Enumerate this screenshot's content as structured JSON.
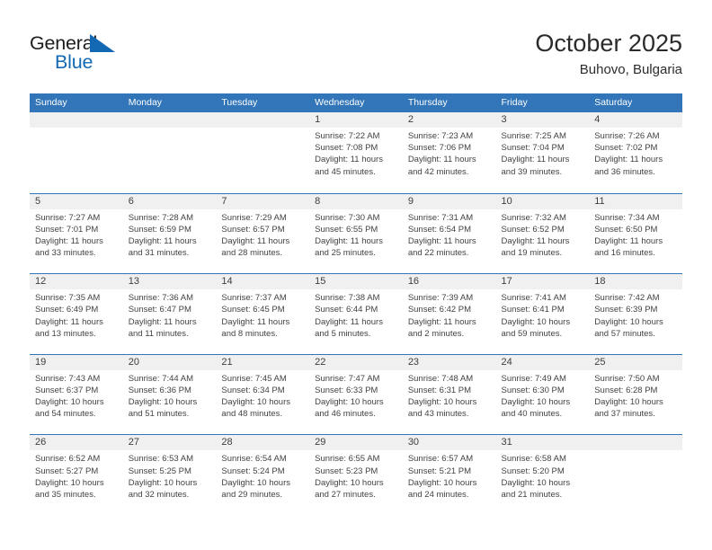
{
  "brand": {
    "name_top": "General",
    "name_bottom": "Blue",
    "triangle_color": "#1268b3"
  },
  "header": {
    "title": "October 2025",
    "location": "Buhovo, Bulgaria"
  },
  "theme": {
    "header_blue": "#3275b8",
    "band_gray": "#f0f0f0",
    "text_dark": "#434343",
    "brand_blue": "#1268b3"
  },
  "weekdays": [
    {
      "label": "Sunday"
    },
    {
      "label": "Monday"
    },
    {
      "label": "Tuesday"
    },
    {
      "label": "Wednesday"
    },
    {
      "label": "Thursday"
    },
    {
      "label": "Friday"
    },
    {
      "label": "Saturday"
    }
  ],
  "weeks": [
    {
      "days": [
        {
          "num": "",
          "l1": "",
          "l2": "",
          "l3": "",
          "l4": "",
          "empty": true
        },
        {
          "num": "",
          "l1": "",
          "l2": "",
          "l3": "",
          "l4": "",
          "empty": true
        },
        {
          "num": "",
          "l1": "",
          "l2": "",
          "l3": "",
          "l4": "",
          "empty": true
        },
        {
          "num": "1",
          "l1": "Sunrise: 7:22 AM",
          "l2": "Sunset: 7:08 PM",
          "l3": "Daylight: 11 hours",
          "l4": "and 45 minutes."
        },
        {
          "num": "2",
          "l1": "Sunrise: 7:23 AM",
          "l2": "Sunset: 7:06 PM",
          "l3": "Daylight: 11 hours",
          "l4": "and 42 minutes."
        },
        {
          "num": "3",
          "l1": "Sunrise: 7:25 AM",
          "l2": "Sunset: 7:04 PM",
          "l3": "Daylight: 11 hours",
          "l4": "and 39 minutes."
        },
        {
          "num": "4",
          "l1": "Sunrise: 7:26 AM",
          "l2": "Sunset: 7:02 PM",
          "l3": "Daylight: 11 hours",
          "l4": "and 36 minutes."
        }
      ]
    },
    {
      "days": [
        {
          "num": "5",
          "l1": "Sunrise: 7:27 AM",
          "l2": "Sunset: 7:01 PM",
          "l3": "Daylight: 11 hours",
          "l4": "and 33 minutes."
        },
        {
          "num": "6",
          "l1": "Sunrise: 7:28 AM",
          "l2": "Sunset: 6:59 PM",
          "l3": "Daylight: 11 hours",
          "l4": "and 31 minutes."
        },
        {
          "num": "7",
          "l1": "Sunrise: 7:29 AM",
          "l2": "Sunset: 6:57 PM",
          "l3": "Daylight: 11 hours",
          "l4": "and 28 minutes."
        },
        {
          "num": "8",
          "l1": "Sunrise: 7:30 AM",
          "l2": "Sunset: 6:55 PM",
          "l3": "Daylight: 11 hours",
          "l4": "and 25 minutes."
        },
        {
          "num": "9",
          "l1": "Sunrise: 7:31 AM",
          "l2": "Sunset: 6:54 PM",
          "l3": "Daylight: 11 hours",
          "l4": "and 22 minutes."
        },
        {
          "num": "10",
          "l1": "Sunrise: 7:32 AM",
          "l2": "Sunset: 6:52 PM",
          "l3": "Daylight: 11 hours",
          "l4": "and 19 minutes."
        },
        {
          "num": "11",
          "l1": "Sunrise: 7:34 AM",
          "l2": "Sunset: 6:50 PM",
          "l3": "Daylight: 11 hours",
          "l4": "and 16 minutes."
        }
      ]
    },
    {
      "days": [
        {
          "num": "12",
          "l1": "Sunrise: 7:35 AM",
          "l2": "Sunset: 6:49 PM",
          "l3": "Daylight: 11 hours",
          "l4": "and 13 minutes."
        },
        {
          "num": "13",
          "l1": "Sunrise: 7:36 AM",
          "l2": "Sunset: 6:47 PM",
          "l3": "Daylight: 11 hours",
          "l4": "and 11 minutes."
        },
        {
          "num": "14",
          "l1": "Sunrise: 7:37 AM",
          "l2": "Sunset: 6:45 PM",
          "l3": "Daylight: 11 hours",
          "l4": "and 8 minutes."
        },
        {
          "num": "15",
          "l1": "Sunrise: 7:38 AM",
          "l2": "Sunset: 6:44 PM",
          "l3": "Daylight: 11 hours",
          "l4": "and 5 minutes."
        },
        {
          "num": "16",
          "l1": "Sunrise: 7:39 AM",
          "l2": "Sunset: 6:42 PM",
          "l3": "Daylight: 11 hours",
          "l4": "and 2 minutes."
        },
        {
          "num": "17",
          "l1": "Sunrise: 7:41 AM",
          "l2": "Sunset: 6:41 PM",
          "l3": "Daylight: 10 hours",
          "l4": "and 59 minutes."
        },
        {
          "num": "18",
          "l1": "Sunrise: 7:42 AM",
          "l2": "Sunset: 6:39 PM",
          "l3": "Daylight: 10 hours",
          "l4": "and 57 minutes."
        }
      ]
    },
    {
      "days": [
        {
          "num": "19",
          "l1": "Sunrise: 7:43 AM",
          "l2": "Sunset: 6:37 PM",
          "l3": "Daylight: 10 hours",
          "l4": "and 54 minutes."
        },
        {
          "num": "20",
          "l1": "Sunrise: 7:44 AM",
          "l2": "Sunset: 6:36 PM",
          "l3": "Daylight: 10 hours",
          "l4": "and 51 minutes."
        },
        {
          "num": "21",
          "l1": "Sunrise: 7:45 AM",
          "l2": "Sunset: 6:34 PM",
          "l3": "Daylight: 10 hours",
          "l4": "and 48 minutes."
        },
        {
          "num": "22",
          "l1": "Sunrise: 7:47 AM",
          "l2": "Sunset: 6:33 PM",
          "l3": "Daylight: 10 hours",
          "l4": "and 46 minutes."
        },
        {
          "num": "23",
          "l1": "Sunrise: 7:48 AM",
          "l2": "Sunset: 6:31 PM",
          "l3": "Daylight: 10 hours",
          "l4": "and 43 minutes."
        },
        {
          "num": "24",
          "l1": "Sunrise: 7:49 AM",
          "l2": "Sunset: 6:30 PM",
          "l3": "Daylight: 10 hours",
          "l4": "and 40 minutes."
        },
        {
          "num": "25",
          "l1": "Sunrise: 7:50 AM",
          "l2": "Sunset: 6:28 PM",
          "l3": "Daylight: 10 hours",
          "l4": "and 37 minutes."
        }
      ]
    },
    {
      "days": [
        {
          "num": "26",
          "l1": "Sunrise: 6:52 AM",
          "l2": "Sunset: 5:27 PM",
          "l3": "Daylight: 10 hours",
          "l4": "and 35 minutes."
        },
        {
          "num": "27",
          "l1": "Sunrise: 6:53 AM",
          "l2": "Sunset: 5:25 PM",
          "l3": "Daylight: 10 hours",
          "l4": "and 32 minutes."
        },
        {
          "num": "28",
          "l1": "Sunrise: 6:54 AM",
          "l2": "Sunset: 5:24 PM",
          "l3": "Daylight: 10 hours",
          "l4": "and 29 minutes."
        },
        {
          "num": "29",
          "l1": "Sunrise: 6:55 AM",
          "l2": "Sunset: 5:23 PM",
          "l3": "Daylight: 10 hours",
          "l4": "and 27 minutes."
        },
        {
          "num": "30",
          "l1": "Sunrise: 6:57 AM",
          "l2": "Sunset: 5:21 PM",
          "l3": "Daylight: 10 hours",
          "l4": "and 24 minutes."
        },
        {
          "num": "31",
          "l1": "Sunrise: 6:58 AM",
          "l2": "Sunset: 5:20 PM",
          "l3": "Daylight: 10 hours",
          "l4": "and 21 minutes."
        },
        {
          "num": "",
          "l1": "",
          "l2": "",
          "l3": "",
          "l4": "",
          "empty": true
        }
      ]
    }
  ]
}
